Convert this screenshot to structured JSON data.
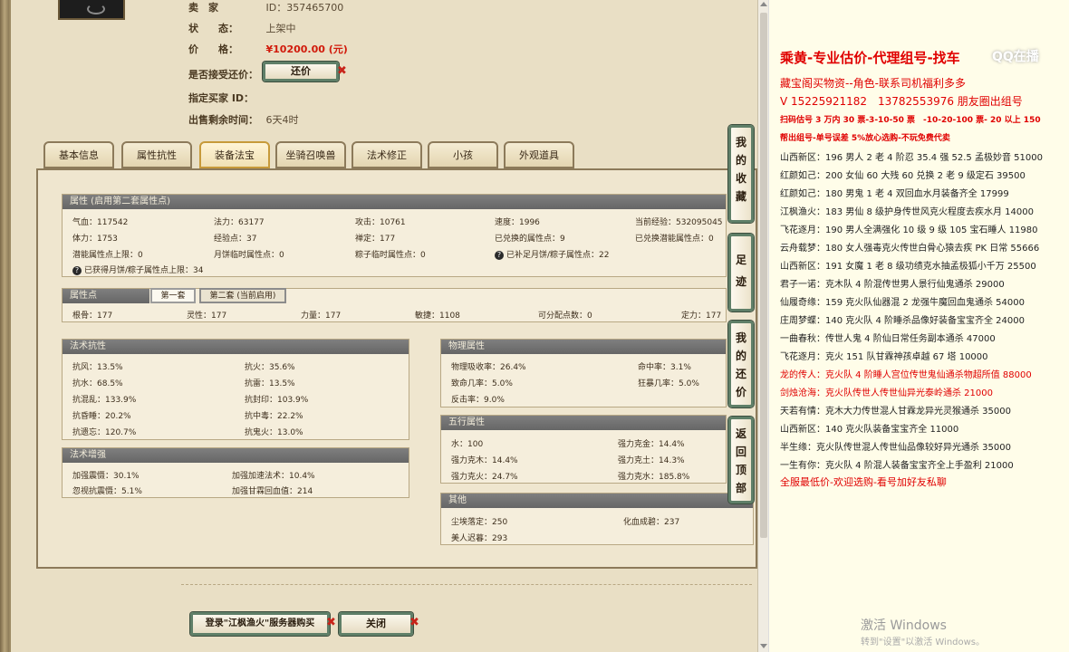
{
  "seller_info": {
    "seller_label": "卖　家",
    "seller_id": "ID：357465700",
    "status_label": "状　　态：",
    "status_value": "上架中",
    "price_label": "价　　格：",
    "price_value": "¥10200.00 (元)",
    "counter_offer_label": "是否接受还价：",
    "counter_offer_button": "还价",
    "buyer_id_label": "指定买家 ID：",
    "remaining_label": "出售剩余时间：",
    "remaining_value": "6天4时"
  },
  "tabs": [
    "基本信息",
    "属性抗性",
    "装备法宝",
    "坐骑召唤兽",
    "法术修正",
    "小孩",
    "外观道具"
  ],
  "active_tab": "装备法宝",
  "attributes": {
    "title": "属性 (启用第二套属性点)",
    "rows": [
      [
        "气血：117542",
        "法力：63177",
        "攻击：10761",
        "速度：1996",
        "当前经验：532095045"
      ],
      [
        "体力：1753",
        "经验点：37",
        "禅定：177",
        "已兑换的属性点：9",
        "已兑换潜能属性点：0"
      ],
      [
        "潜能属性点上限：0",
        "月饼临时属性点：0",
        "粽子临时属性点：0",
        "已补足月饼/粽子属性点：22"
      ]
    ],
    "note": "已获得月饼/粽子属性点上限：34"
  },
  "attribute_points": {
    "title": "属性点",
    "subtab_1": "第一套",
    "subtab_2": "第二套 (当前启用)",
    "values": [
      "根骨：177",
      "灵性：177",
      "力量：177",
      "敏捷：1108",
      "可分配点数：0",
      "定力：177"
    ]
  },
  "spell_resist": {
    "title": "法术抗性",
    "values": [
      "抗风：13.5%",
      "抗火：35.6%",
      "抗水：68.5%",
      "抗雷：13.5%",
      "抗混乱：133.9%",
      "抗封印：103.9%",
      "抗昏睡：20.2%",
      "抗中毒：22.2%",
      "抗遗忘：120.7%",
      "抗鬼火：13.0%"
    ]
  },
  "spell_boost": {
    "title": "法术增强",
    "values": [
      "加强震慑：30.1%",
      "加强加速法术：10.4%",
      "忽视抗震慑：5.1%",
      "加强甘霖回血值：214"
    ]
  },
  "physical": {
    "title": "物理属性",
    "values": [
      "物理吸收率：26.4%",
      "命中率：3.1%",
      "致命几率：5.0%",
      "狂暴几率：5.0%",
      "反击率：9.0%"
    ]
  },
  "five_elements": {
    "title": "五行属性",
    "values": [
      "水：100",
      "强力克金：14.4%",
      "强力克木：14.4%",
      "强力克土：14.3%",
      "强力克火：24.7%",
      "强力克水：185.8%"
    ]
  },
  "other": {
    "title": "其他",
    "values": [
      "尘埃落定：250",
      "化血成碧：237",
      "美人迟暮：293"
    ]
  },
  "side_buttons": [
    "我的收藏",
    "足迹",
    "我的还价",
    "返回顶部"
  ],
  "bottom_buttons": {
    "login": "登录\"江枫渔火\"服务器购买",
    "close": "关闭"
  },
  "doc": {
    "header": "乘黄-专业估价-代理组号-找车",
    "line2": "藏宝阁买物资--角色-联系司机福利多多",
    "line3": "V 15225921182　13782553976 朋友圈出组号",
    "line4": "扫码估号 3 万内 30 票-3-10-50 票　-10-20-100 票- 20 以上 150",
    "line5": "帮出组号-单号误差 5%放心选购-不玩免费代卖",
    "listings": [
      {
        "text": "山西新区：196 男人 2 老 4 阶忍 35.4 强 52.5 孟极妙音 51000",
        "red": false
      },
      {
        "text": "红颜如己：200 女仙 60 大残 60 兑换 2 老 9 级定石 39500",
        "red": false
      },
      {
        "text": "红颜如己：180 男鬼 1 老 4 双回血水月装备齐全 17999",
        "red": false
      },
      {
        "text": "江枫渔火：183 男仙 8 级护身传世风克火程度去疾水月 14000",
        "red": false
      },
      {
        "text": "飞花逐月：190 男人全满强化 10 级 9 级 105 宝石睡人 11980",
        "red": false
      },
      {
        "text": "云舟载梦：180 女人强毒克火传世白骨心猿去疾 PK 日常 55666",
        "red": false
      },
      {
        "text": "山西新区：191 女魔 1 老 8 级功绩克水抽孟极狐小千万 25500",
        "red": false
      },
      {
        "text": "君子一诺：克木队 4 阶混传世男人景行仙鬼通杀 29000",
        "red": false
      },
      {
        "text": "仙履奇缘：159 克火队仙器混 2 龙强牛魔回血鬼通杀 54000",
        "red": false
      },
      {
        "text": "庄周梦蝶：140 克火队 4 阶睡杀品像好装备宝宝齐全 24000",
        "red": false
      },
      {
        "text": "一曲春秋：传世人鬼 4 阶仙日常任务副本通杀 47000",
        "red": false
      },
      {
        "text": "飞花逐月：克火 151 队甘霖神孩卓越 67 塔 10000",
        "red": false
      },
      {
        "text": "龙的传人：克火队 4 阶睡人宫位传世鬼仙通杀物超所值 88000",
        "red": true
      },
      {
        "text": "剑烛沧海：克火队传世人传世仙异光泰岭通杀 21000",
        "red": true
      },
      {
        "text": "天若有情：克木大力传世混人甘霖龙异光灵猴通杀 35000",
        "red": false
      },
      {
        "text": "山西新区：140 克火队装备宝宝齐全 11000",
        "red": false
      },
      {
        "text": "半生缘：克火队传世混人传世仙品像较好异光通杀 35000",
        "red": false
      },
      {
        "text": "一生有你：克火队 4 阶混人装备宝宝齐全上手盈利 21000",
        "red": false
      }
    ],
    "footer": "全服最低价-欢迎选购-看号加好友私聊",
    "watermark": "激活 Windows",
    "watermark_sub": "转到\"设置\"以激活 Windows。",
    "logo": "QQ在播"
  },
  "colors": {
    "accent_red": "#d11a0b",
    "button_border": "#5f7f68",
    "section_head": "#6f6f6f"
  }
}
